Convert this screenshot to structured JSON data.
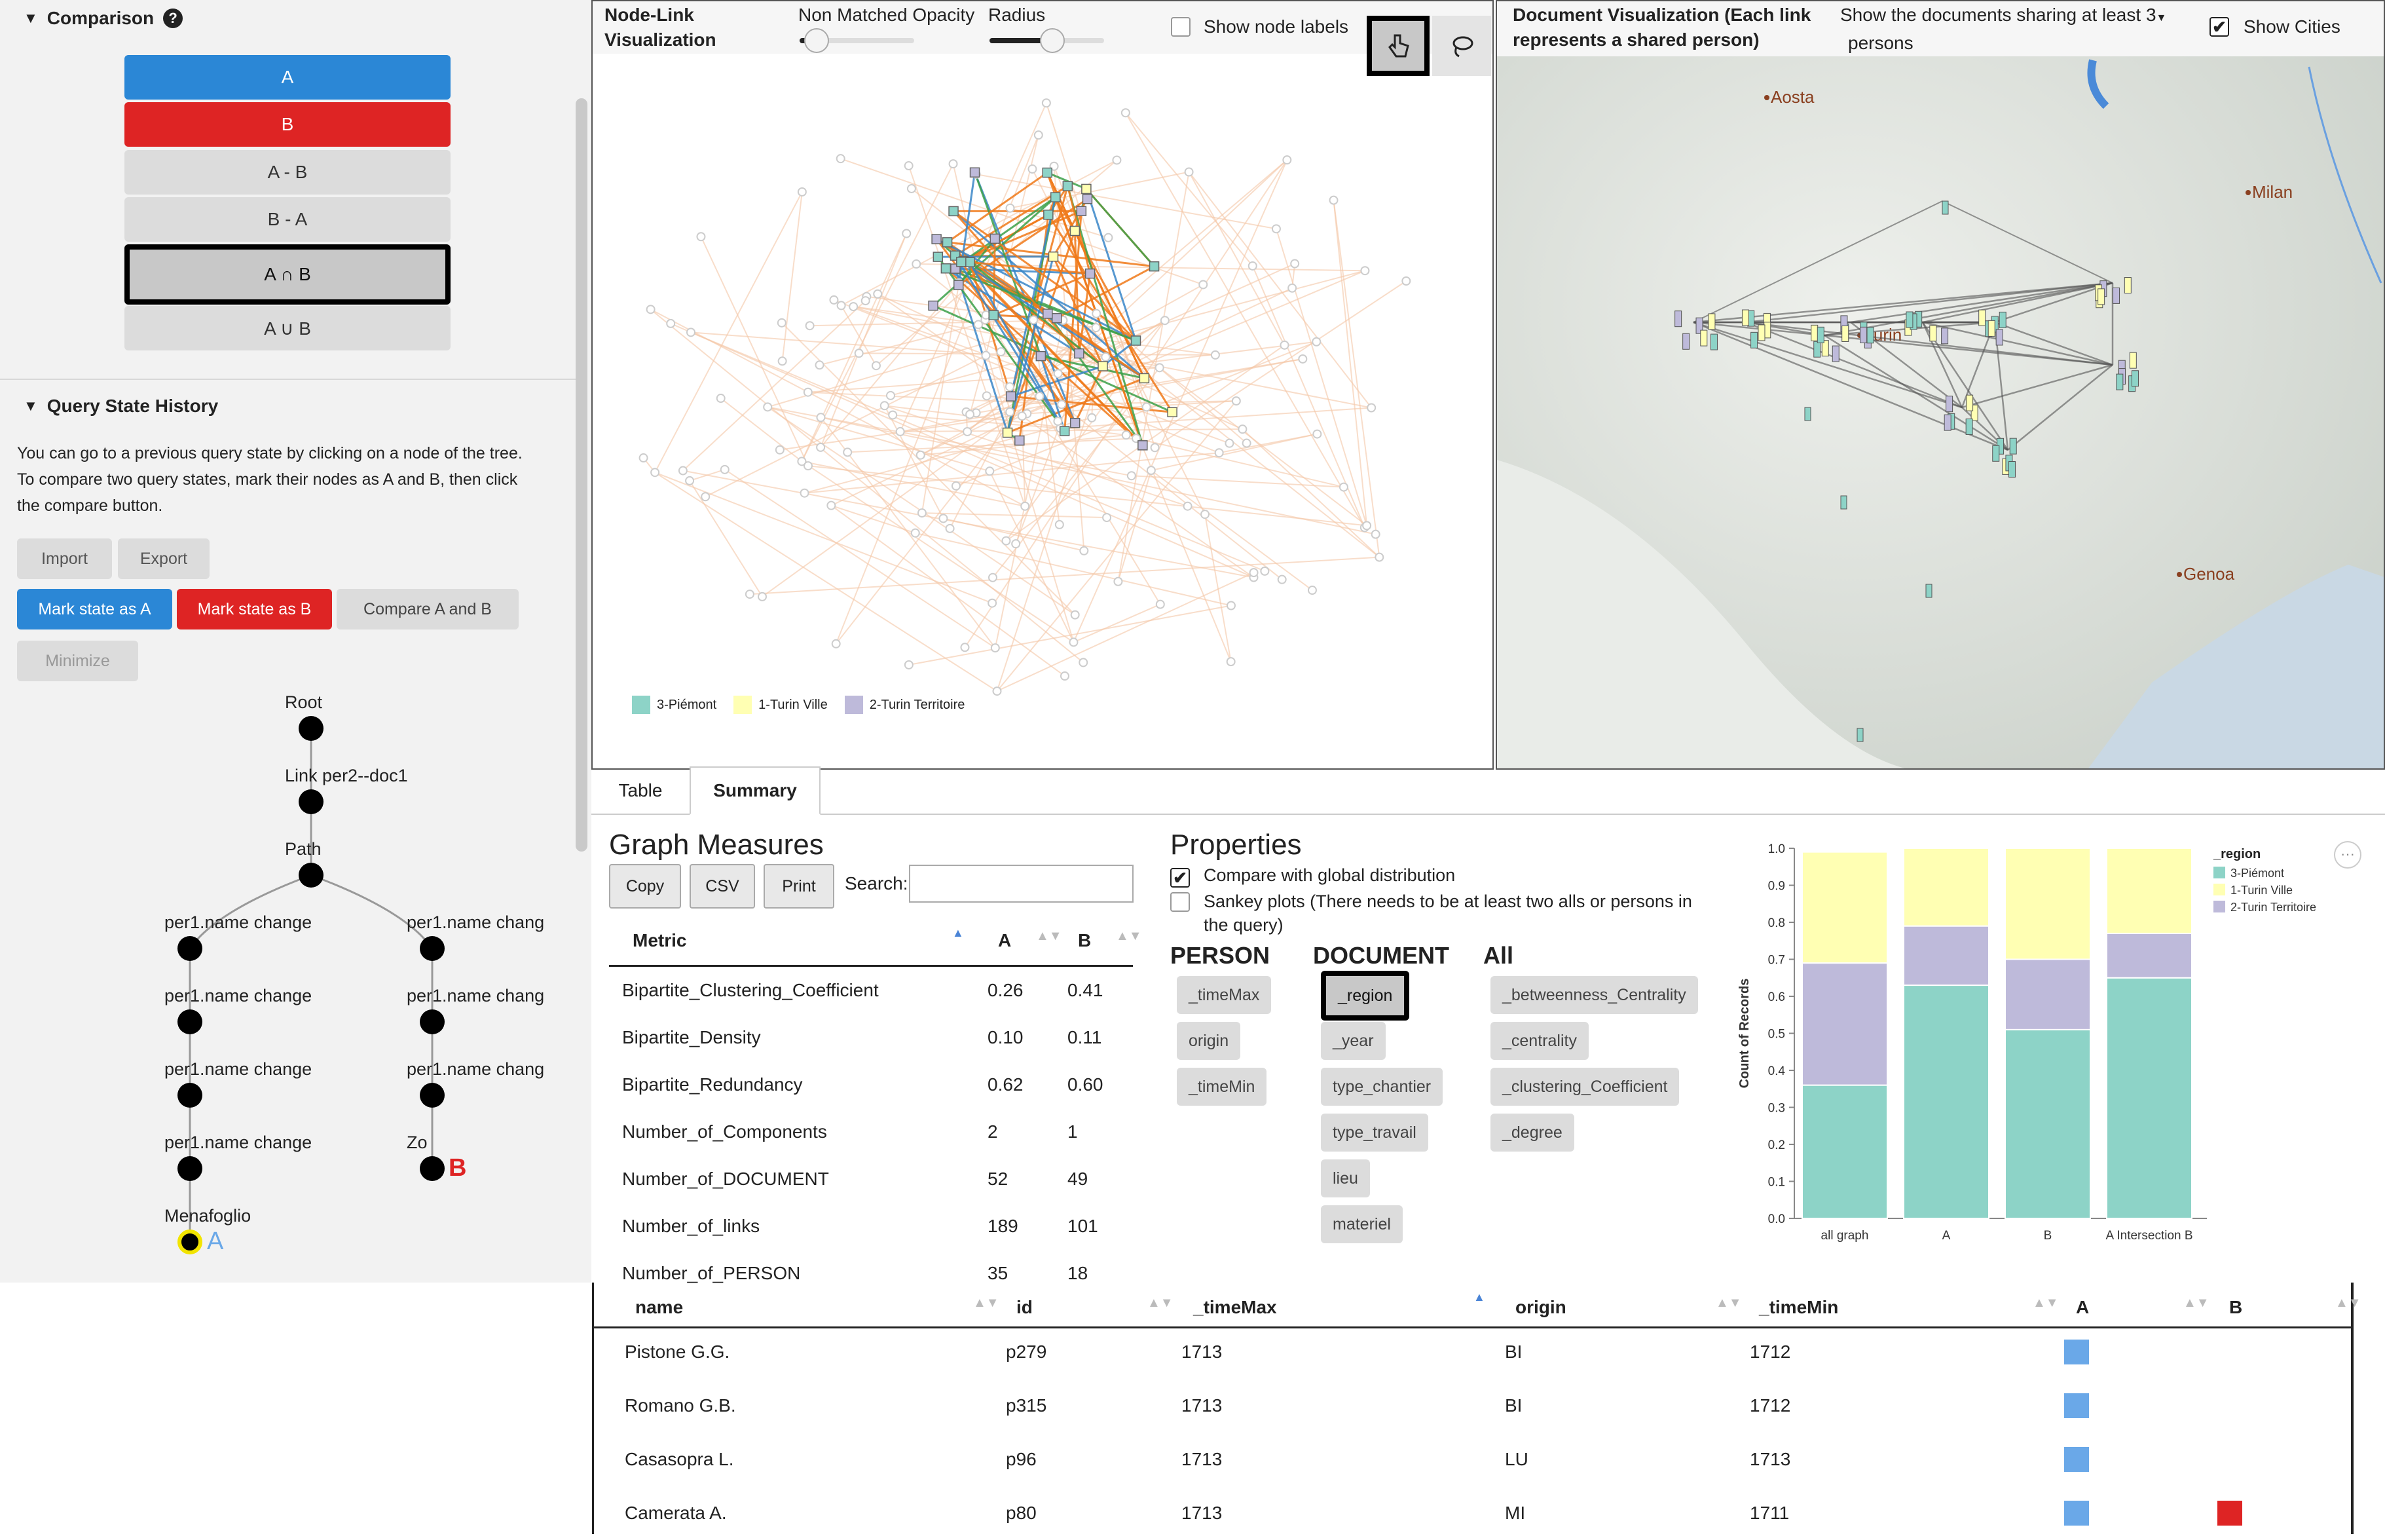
{
  "comparison": {
    "title": "Comparison",
    "help_icon": "question-circle-icon",
    "buttons": [
      {
        "label": "A",
        "color": "#2b87d6"
      },
      {
        "label": "B",
        "color": "#de2424"
      },
      {
        "label": "A - B"
      },
      {
        "label": "B - A"
      },
      {
        "label": "A ∩ B",
        "selected": true
      },
      {
        "label": "A ∪ B"
      }
    ]
  },
  "history": {
    "title": "Query State History",
    "description": "You can go to a previous query state by clicking on a node of the tree. To compare two query states, mark their nodes as A and B, then click the compare button.",
    "import": "Import",
    "export": "Export",
    "mark_a": "Mark state as A",
    "mark_b": "Mark state as B",
    "compare": "Compare A and B",
    "minimize": "Minimize",
    "tree": {
      "root": "Root",
      "link": "Link per2--doc1",
      "path": "Path",
      "left": [
        "per1.name change",
        "per1.name change",
        "per1.name change",
        "per1.name change"
      ],
      "right": [
        "per1.name chang",
        "per1.name chang",
        "per1.name chang",
        "Zo"
      ],
      "leaf": "Menafoglio",
      "marker_a": "A",
      "marker_b": "B"
    }
  },
  "nodelink": {
    "title": "Node-Link Visualization",
    "opacity_label": "Non Matched Opacity",
    "opacity_value": 0.15,
    "radius_label": "Radius",
    "radius_value": 0.55,
    "show_labels": "Show node labels",
    "tools": [
      "hand-pointer-icon",
      "lasso-icon"
    ],
    "legend": [
      {
        "label": "3-Piémont",
        "color": "#8dd3c7"
      },
      {
        "label": "1-Turin Ville",
        "color": "#ffffb3"
      },
      {
        "label": "2-Turin Territoire",
        "color": "#bebada"
      }
    ]
  },
  "docviz": {
    "title": "Document Visualization (Each link represents a shared person)",
    "sharing_prefix": "Show the documents sharing at least",
    "sharing_value": "3",
    "sharing_suffix": "persons",
    "show_cities": "Show Cities",
    "cities": [
      "Aosta",
      "Milan",
      "Turin",
      "Genoa"
    ]
  },
  "tabs": [
    "Table",
    "Summary"
  ],
  "active_tab": "Summary",
  "measures": {
    "title": "Graph Measures",
    "buttons": [
      "Copy",
      "CSV",
      "Print"
    ],
    "search_label": "Search:",
    "search_value": "",
    "columns": [
      "Metric",
      "A",
      "B"
    ],
    "rows": [
      [
        "Bipartite_Clustering_Coefficient",
        "0.26",
        "0.41"
      ],
      [
        "Bipartite_Density",
        "0.10",
        "0.11"
      ],
      [
        "Bipartite_Redundancy",
        "0.62",
        "0.60"
      ],
      [
        "Number_of_Components",
        "2",
        "1"
      ],
      [
        "Number_of_DOCUMENT",
        "52",
        "49"
      ],
      [
        "Number_of_links",
        "189",
        "101"
      ],
      [
        "Number_of_PERSON",
        "35",
        "18"
      ]
    ]
  },
  "properties": {
    "title": "Properties",
    "compare_global": "Compare with global distribution",
    "sankey": "Sankey plots (There needs to be at least two alls or persons in the query)",
    "person": {
      "title": "PERSON",
      "items": [
        "_timeMax",
        "origin",
        "_timeMin"
      ]
    },
    "document": {
      "title": "DOCUMENT",
      "items": [
        "_region",
        "_year",
        "type_chantier",
        "type_travail",
        "lieu",
        "materiel"
      ],
      "selected": "_region"
    },
    "all": {
      "title": "All",
      "items": [
        "_betweenness_Centrality",
        "_centrality",
        "_clustering_Coefficient",
        "_degree"
      ]
    }
  },
  "chart_data": {
    "type": "bar",
    "stacked": true,
    "categories": [
      "all graph",
      "A",
      "B",
      "A Intersection B"
    ],
    "ylabel": "Count of Records",
    "ylim": [
      0,
      1
    ],
    "yticks": [
      "0.0",
      "0.1",
      "0.2",
      "0.3",
      "0.4",
      "0.5",
      "0.6",
      "0.7",
      "0.8",
      "0.9",
      "1.0"
    ],
    "legend_title": "_region",
    "series": [
      {
        "name": "3-Piémont",
        "color": "#8dd3c7",
        "values": [
          0.36,
          0.63,
          0.51,
          0.65
        ]
      },
      {
        "name": "2-Turin Territoire",
        "color": "#bebada",
        "values": [
          0.33,
          0.16,
          0.19,
          0.12
        ]
      },
      {
        "name": "1-Turin Ville",
        "color": "#ffffb3",
        "values": [
          0.3,
          0.21,
          0.3,
          0.23
        ]
      }
    ],
    "legend": [
      "3-Piémont",
      "1-Turin Ville",
      "2-Turin Territoire"
    ]
  },
  "bottom_table": {
    "columns": [
      "name",
      "id",
      "_timeMax",
      "origin",
      "_timeMin",
      "A",
      "B"
    ],
    "rows": [
      {
        "name": "Pistone G.G.",
        "id": "p279",
        "timeMax": "1713",
        "origin": "BI",
        "timeMin": "1712",
        "a": true,
        "b": false
      },
      {
        "name": "Romano G.B.",
        "id": "p315",
        "timeMax": "1713",
        "origin": "BI",
        "timeMin": "1712",
        "a": true,
        "b": false
      },
      {
        "name": "Casasopra L.",
        "id": "p96",
        "timeMax": "1713",
        "origin": "LU",
        "timeMin": "1713",
        "a": true,
        "b": false
      },
      {
        "name": "Camerata A.",
        "id": "p80",
        "timeMax": "1713",
        "origin": "MI",
        "timeMin": "1711",
        "a": true,
        "b": true
      }
    ]
  }
}
